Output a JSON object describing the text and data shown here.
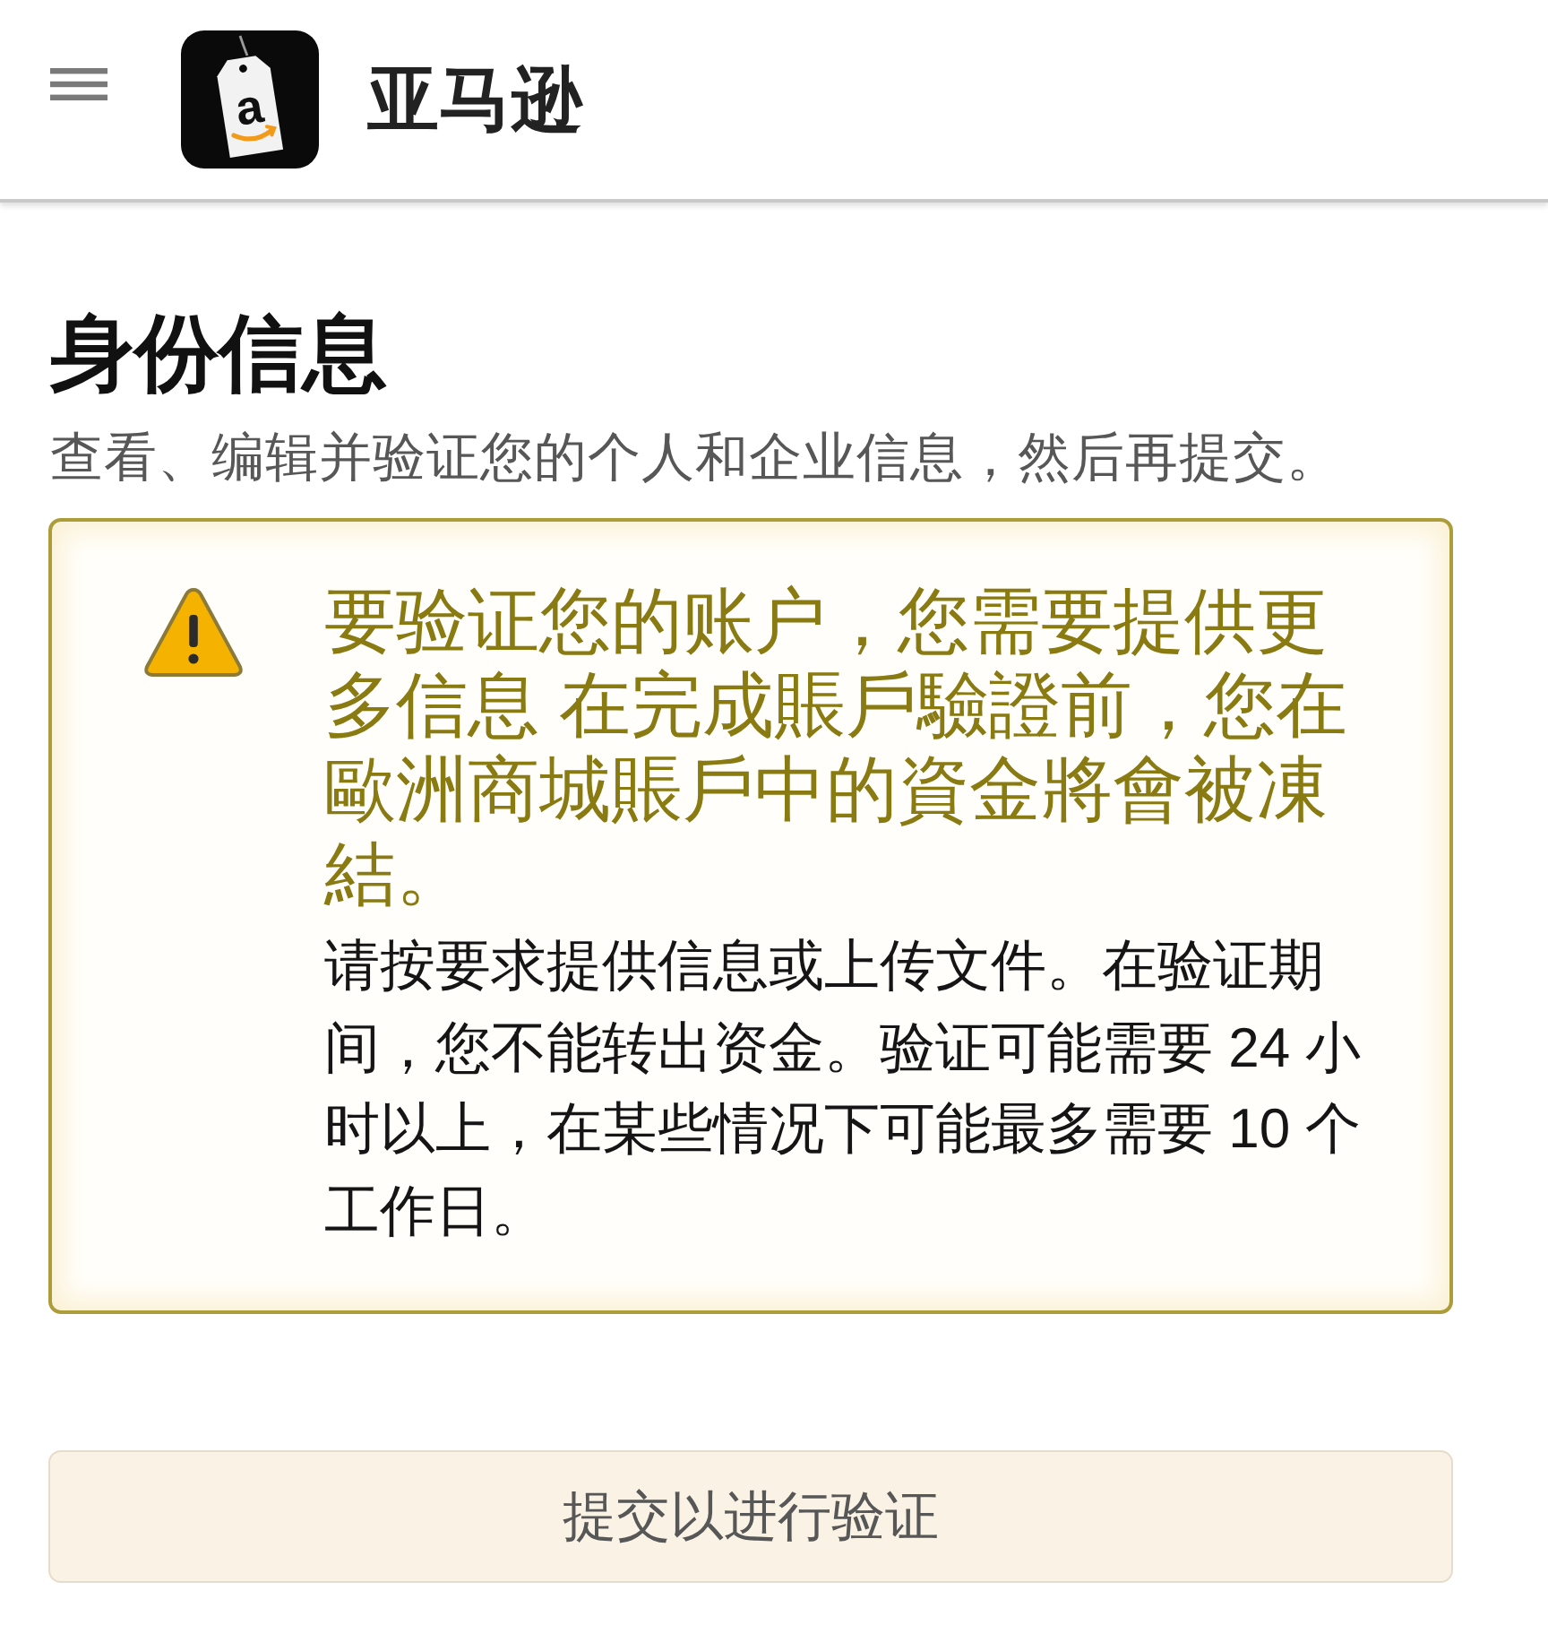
{
  "app_bar": {
    "logo_letter": "a",
    "title": "亚马逊"
  },
  "page": {
    "heading": "身份信息",
    "subtitle": "查看、编辑并验证您的个人和企业信息，然后再提交。"
  },
  "alert": {
    "kind": "warning",
    "title": "要验证您的账户，您需要提供更多信息 在完成賬戶驗證前，您在歐洲商城賬戶中的資金將會被凍結。",
    "body": "请按要求提供信息或上传文件。在验证期间，您不能转出资金。验证可能需要 24 小时以上，在某些情况下可能最多需要 10 个工作日。"
  },
  "submit_button": {
    "label": "提交以进行验证",
    "disabled": true
  }
}
